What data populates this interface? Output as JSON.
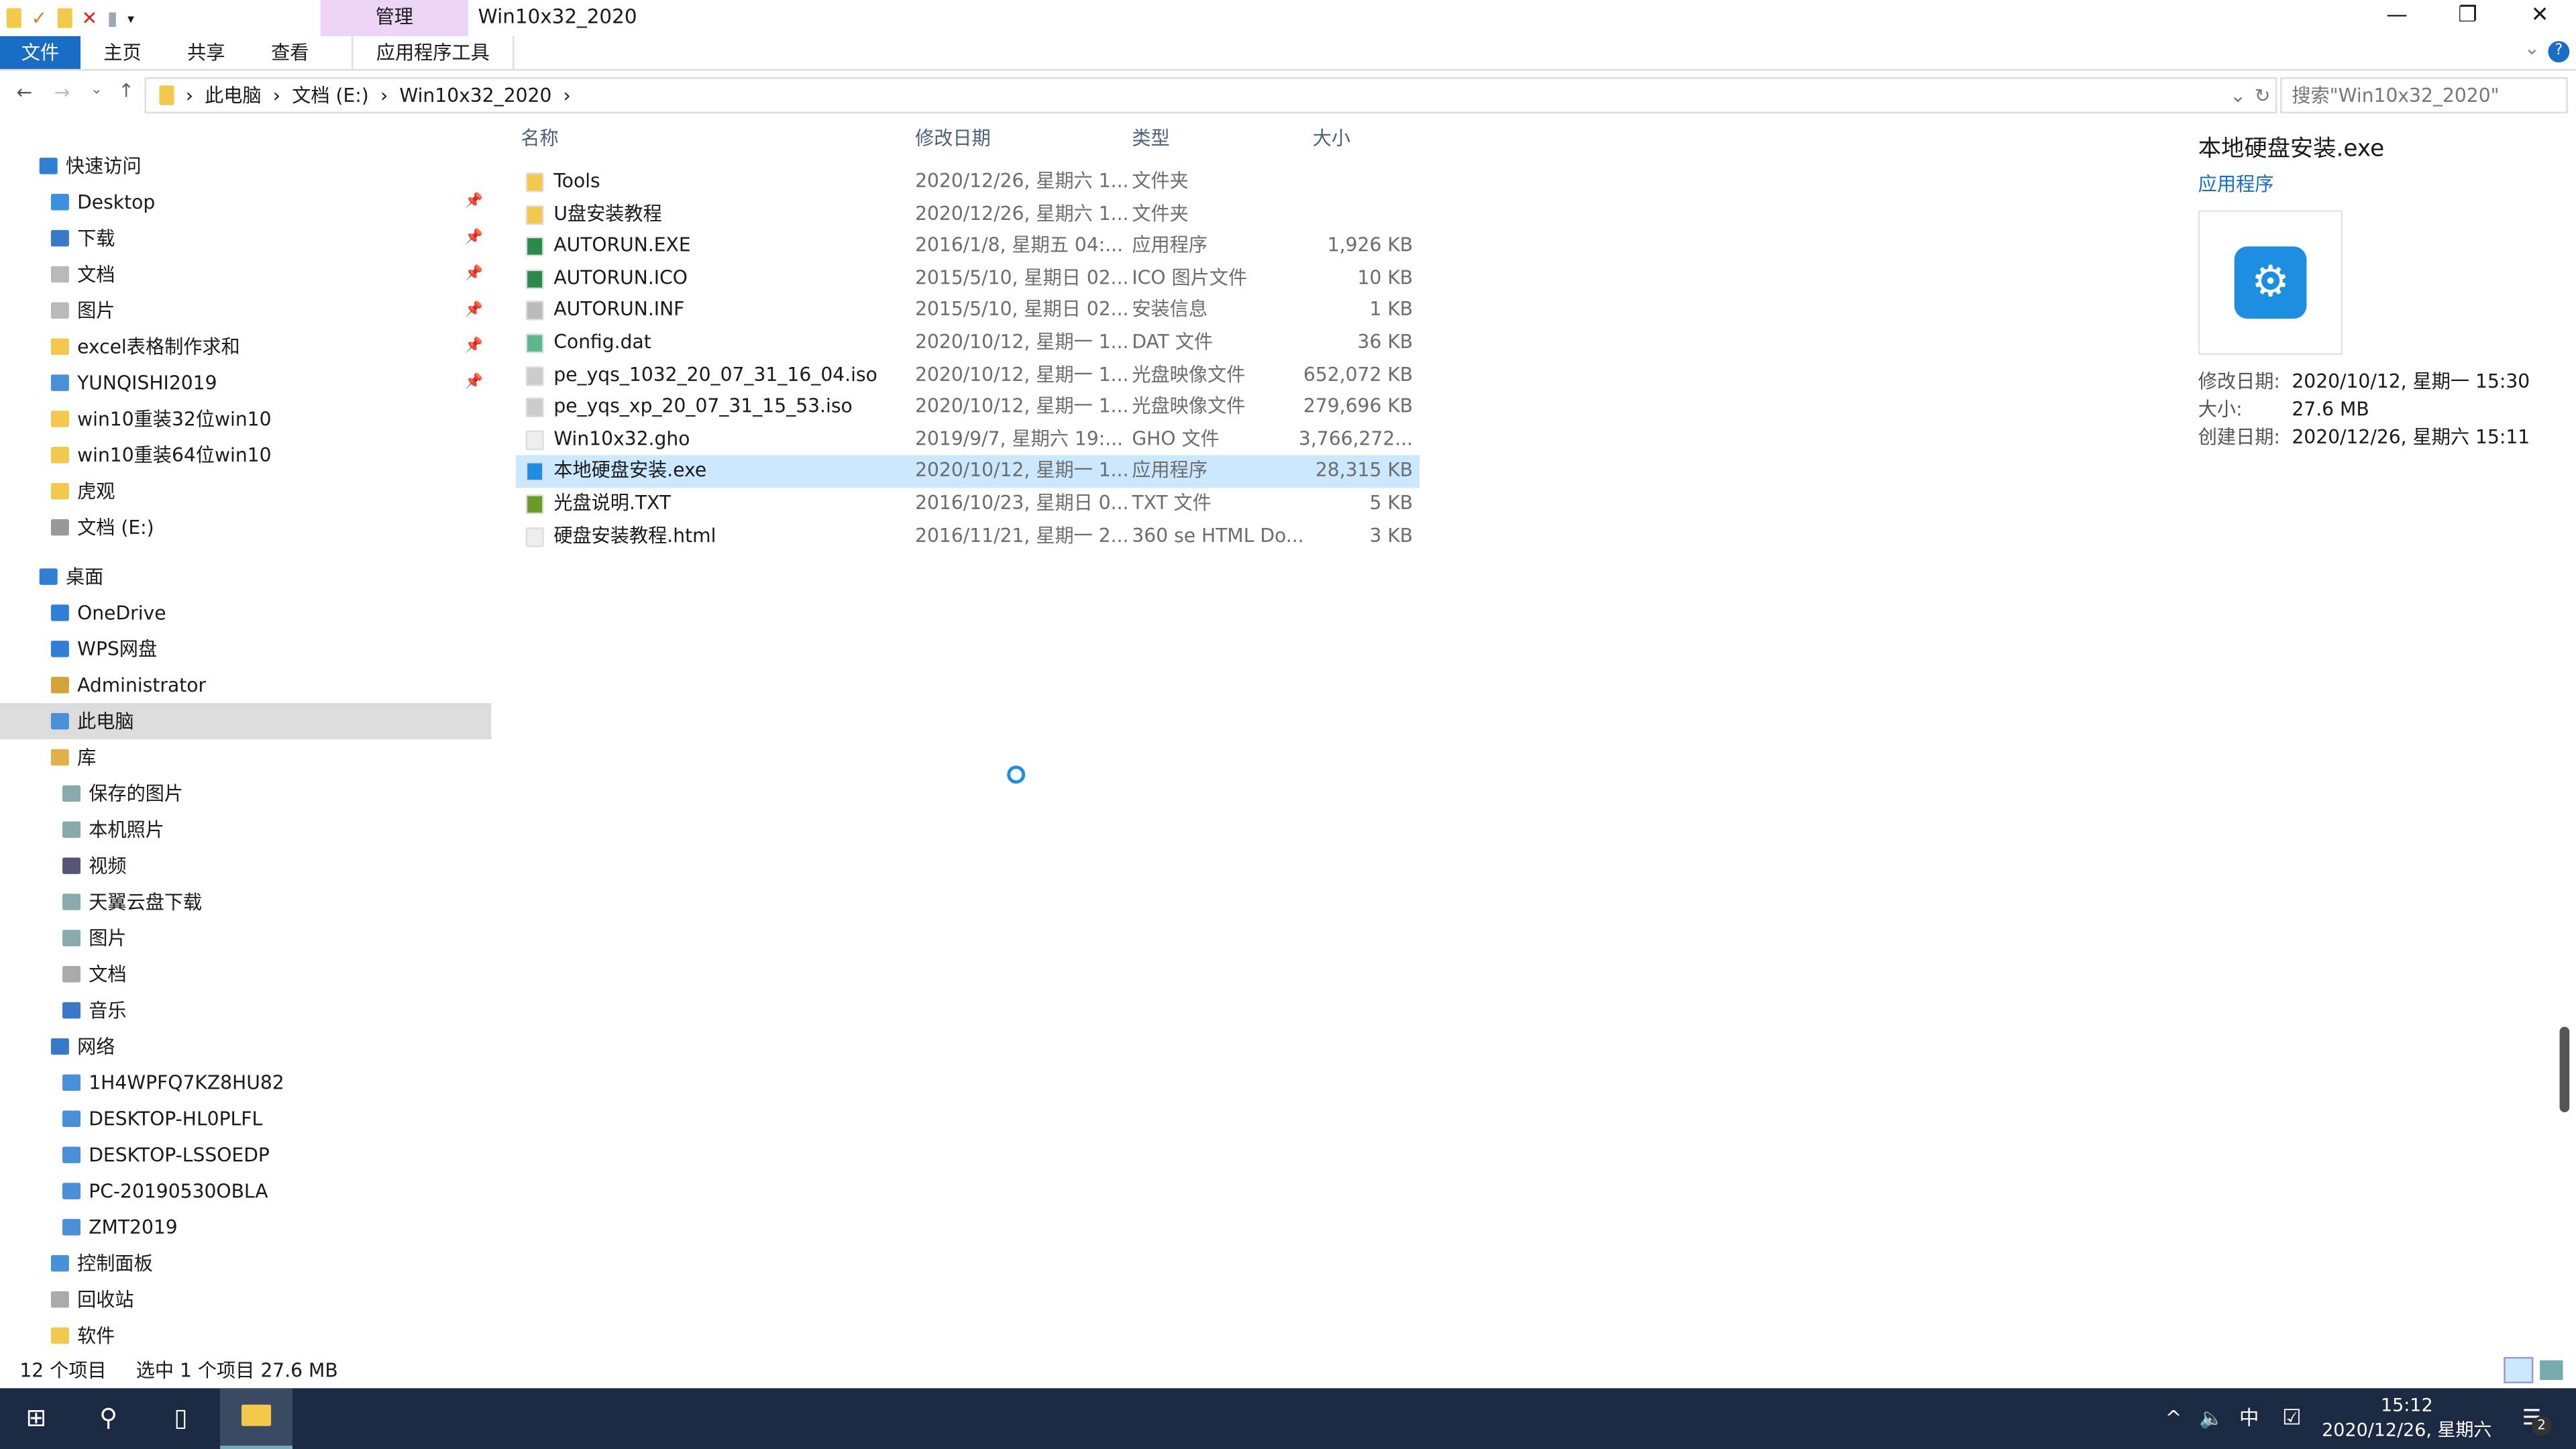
{
  "window": {
    "title": "Win10x32_2020",
    "context_tab": "管理",
    "min": "—",
    "restore": "❐",
    "close": "✕"
  },
  "ribbon": {
    "tabs": [
      "文件",
      "主页",
      "共享",
      "查看",
      "应用程序工具"
    ]
  },
  "address": {
    "crumbs": [
      "此电脑",
      "文档 (E:)",
      "Win10x32_2020"
    ],
    "search_placeholder": "搜索\"Win10x32_2020\""
  },
  "sidebar": {
    "items": [
      {
        "label": "快速访问",
        "level": 0,
        "color": "#2f7fd6"
      },
      {
        "label": "Desktop",
        "level": 1,
        "color": "#3d8fe0",
        "pin": true
      },
      {
        "label": "下载",
        "level": 1,
        "color": "#3a78c8",
        "pin": true
      },
      {
        "label": "文档",
        "level": 1,
        "color": "#b9b9b9",
        "pin": true
      },
      {
        "label": "图片",
        "level": 1,
        "color": "#b9b9b9",
        "pin": true
      },
      {
        "label": "excel表格制作求和",
        "level": 1,
        "color": "#f2c94c",
        "pin": true
      },
      {
        "label": "YUNQISHI2019",
        "level": 1,
        "color": "#4a90d9",
        "pin": true
      },
      {
        "label": "win10重装32位win10",
        "level": 1,
        "color": "#f2c94c"
      },
      {
        "label": "win10重装64位win10",
        "level": 1,
        "color": "#f2c94c"
      },
      {
        "label": "虎观",
        "level": 1,
        "color": "#f2c94c"
      },
      {
        "label": "文档 (E:)",
        "level": 1,
        "color": "#999"
      },
      {
        "label": "桌面",
        "level": 0,
        "color": "#2f7fd6"
      },
      {
        "label": "OneDrive",
        "level": 1,
        "color": "#2f7fd6"
      },
      {
        "label": "WPS网盘",
        "level": 1,
        "color": "#2f7fd6"
      },
      {
        "label": "Administrator",
        "level": 1,
        "color": "#d4a23a"
      },
      {
        "label": "此电脑",
        "level": 1,
        "color": "#4a90d9",
        "selected": true
      },
      {
        "label": "库",
        "level": 1,
        "color": "#e0b14a"
      },
      {
        "label": "保存的图片",
        "level": 2,
        "color": "#8aa"
      },
      {
        "label": "本机照片",
        "level": 2,
        "color": "#8aa"
      },
      {
        "label": "视频",
        "level": 2,
        "color": "#557"
      },
      {
        "label": "天翼云盘下载",
        "level": 2,
        "color": "#8aa"
      },
      {
        "label": "图片",
        "level": 2,
        "color": "#8aa"
      },
      {
        "label": "文档",
        "level": 2,
        "color": "#aaa"
      },
      {
        "label": "音乐",
        "level": 2,
        "color": "#3a78c8"
      },
      {
        "label": "网络",
        "level": 1,
        "color": "#3a78c8"
      },
      {
        "label": "1H4WPFQ7KZ8HU82",
        "level": 2,
        "color": "#4a90d9"
      },
      {
        "label": "DESKTOP-HL0PLFL",
        "level": 2,
        "color": "#4a90d9"
      },
      {
        "label": "DESKTOP-LSSOEDP",
        "level": 2,
        "color": "#4a90d9"
      },
      {
        "label": "PC-20190530OBLA",
        "level": 2,
        "color": "#4a90d9"
      },
      {
        "label": "ZMT2019",
        "level": 2,
        "color": "#4a90d9"
      },
      {
        "label": "控制面板",
        "level": 1,
        "color": "#4a90d9"
      },
      {
        "label": "回收站",
        "level": 1,
        "color": "#aaa"
      },
      {
        "label": "软件",
        "level": 1,
        "color": "#f2c94c"
      }
    ]
  },
  "columns": [
    "名称",
    "修改日期",
    "类型",
    "大小"
  ],
  "files": [
    {
      "name": "Tools",
      "date": "2020/12/26, 星期六 1...",
      "type": "文件夹",
      "size": "",
      "icon": "folder-icon",
      "color": "#f2c94c"
    },
    {
      "name": "U盘安装教程",
      "date": "2020/12/26, 星期六 1...",
      "type": "文件夹",
      "size": "",
      "icon": "folder-icon",
      "color": "#f2c94c"
    },
    {
      "name": "AUTORUN.EXE",
      "date": "2016/1/8, 星期五 04:...",
      "type": "应用程序",
      "size": "1,926 KB",
      "icon": "app-icon",
      "color": "#2a8a4a"
    },
    {
      "name": "AUTORUN.ICO",
      "date": "2015/5/10, 星期日 02...",
      "type": "ICO 图片文件",
      "size": "10 KB",
      "icon": "image-icon",
      "color": "#2a8a4a"
    },
    {
      "name": "AUTORUN.INF",
      "date": "2015/5/10, 星期日 02...",
      "type": "安装信息",
      "size": "1 KB",
      "icon": "settings-file-icon",
      "color": "#bbb"
    },
    {
      "name": "Config.dat",
      "date": "2020/10/12, 星期一 1...",
      "type": "DAT 文件",
      "size": "36 KB",
      "icon": "dat-file-icon",
      "color": "#5cb88a"
    },
    {
      "name": "pe_yqs_1032_20_07_31_16_04.iso",
      "date": "2020/10/12, 星期一 1...",
      "type": "光盘映像文件",
      "size": "652,072 KB",
      "icon": "disc-icon",
      "color": "#ccc"
    },
    {
      "name": "pe_yqs_xp_20_07_31_15_53.iso",
      "date": "2020/10/12, 星期一 1...",
      "type": "光盘映像文件",
      "size": "279,696 KB",
      "icon": "disc-icon",
      "color": "#ccc"
    },
    {
      "name": "Win10x32.gho",
      "date": "2019/9/7, 星期六 19:...",
      "type": "GHO 文件",
      "size": "3,766,272...",
      "icon": "file-icon",
      "color": "#eee"
    },
    {
      "name": "本地硬盘安装.exe",
      "date": "2020/10/12, 星期一 1...",
      "type": "应用程序",
      "size": "28,315 KB",
      "icon": "installer-icon",
      "color": "#1e8ee0",
      "selected": true
    },
    {
      "name": "光盘说明.TXT",
      "date": "2016/10/23, 星期日 0...",
      "type": "TXT 文件",
      "size": "5 KB",
      "icon": "text-file-icon",
      "color": "#6a9a2a"
    },
    {
      "name": "硬盘安装教程.html",
      "date": "2016/11/21, 星期一 2...",
      "type": "360 se HTML Do...",
      "size": "3 KB",
      "icon": "file-icon",
      "color": "#eee"
    }
  ],
  "preview": {
    "name": "本地硬盘安装.exe",
    "kind": "应用程序",
    "fields": [
      [
        "修改日期:",
        "2020/10/12, 星期一 15:30"
      ],
      [
        "大小:",
        "27.6 MB"
      ],
      [
        "创建日期:",
        "2020/12/26, 星期六 15:11"
      ]
    ]
  },
  "status": {
    "count": "12 个项目",
    "selection": "选中 1 个项目  27.6 MB"
  },
  "taskbar": {
    "time": "15:12",
    "date": "2020/12/26, 星期六",
    "ime": "中",
    "notifications": "2",
    "bg": "#1b2a42"
  }
}
